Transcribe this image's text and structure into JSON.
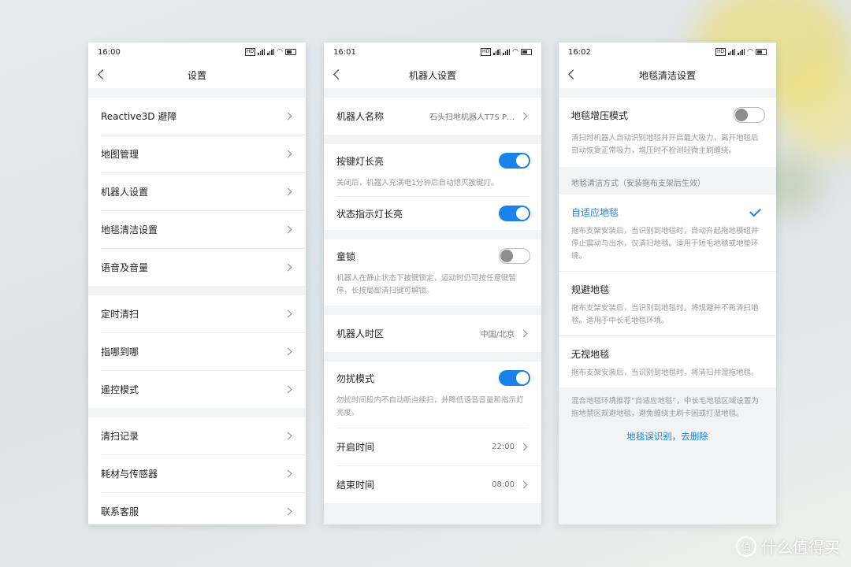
{
  "colors": {
    "accent": "#1a82e8"
  },
  "phone1": {
    "time": "16:00",
    "title": "设置",
    "groups": [
      [
        "Reactive3D 避障",
        "地图管理",
        "机器人设置",
        "地毯清洁设置",
        "语音及音量"
      ],
      [
        "定时清扫",
        "指哪到哪",
        "遥控模式"
      ],
      [
        "清扫记录",
        "耗材与传感器",
        "联系客服"
      ]
    ]
  },
  "phone2": {
    "time": "16:01",
    "title": "机器人设置",
    "robot_name_label": "机器人名称",
    "robot_name_value": "石头扫地机器人T7S P…",
    "key_light_label": "按键灯长亮",
    "key_light_on": true,
    "key_light_desc": "关闭后，机器人充满电1分钟后自动熄灭按键灯。",
    "status_light_label": "状态指示灯长亮",
    "status_light_on": true,
    "child_lock_label": "童锁",
    "child_lock_on": false,
    "child_lock_desc": "机器人在静止状态下按键锁定，运动时仍可按任意键暂停，长按局部清扫键可解锁。",
    "timezone_label": "机器人时区",
    "timezone_value": "中国/北京",
    "dnd_label": "勿扰模式",
    "dnd_on": true,
    "dnd_desc": "勿扰时间段内不自动断点续扫，并降低语音音量和指示灯亮度。",
    "start_label": "开启时间",
    "start_value": "22:00",
    "end_label": "结束时间",
    "end_value": "08:00"
  },
  "phone3": {
    "time": "16:02",
    "title": "地毯清洁设置",
    "boost_label": "地毯增压模式",
    "boost_on": false,
    "boost_desc": "清扫时机器人自动识别地毯并开启最大吸力，离开地毯后自动恢复正常吸力，增压时不检测轻微主刷缠绕。",
    "mode_section_label": "地毯清洁方式（安装拖布支架后生效）",
    "options": [
      {
        "title": "自适应地毯",
        "desc": "拖布支架安装后，当识别到地毯时，自动升起拖地模组并停止震动与出水，仅清扫地毯。适用于短毛地毯或地垫环境。"
      },
      {
        "title": "规避地毯",
        "desc": "拖布支架安装后，当识别到地毯时，将规避并不再清扫地毯。适用于中长毛地毯环境。"
      },
      {
        "title": "无视地毯",
        "desc": "拖布支架安装后，当识别到地毯时，将清扫并湿拖地毯。"
      }
    ],
    "footer_note": "混合地毯环境推荐“自适应地毯”，中长毛地毯区域设置为拖地禁区规避地毯，避免缠绕主刷卡困或打湿地毯。",
    "delete_link": "地毯误识别，去删除"
  },
  "watermark": {
    "text": "什么值得买",
    "icon_glyph": "值"
  }
}
